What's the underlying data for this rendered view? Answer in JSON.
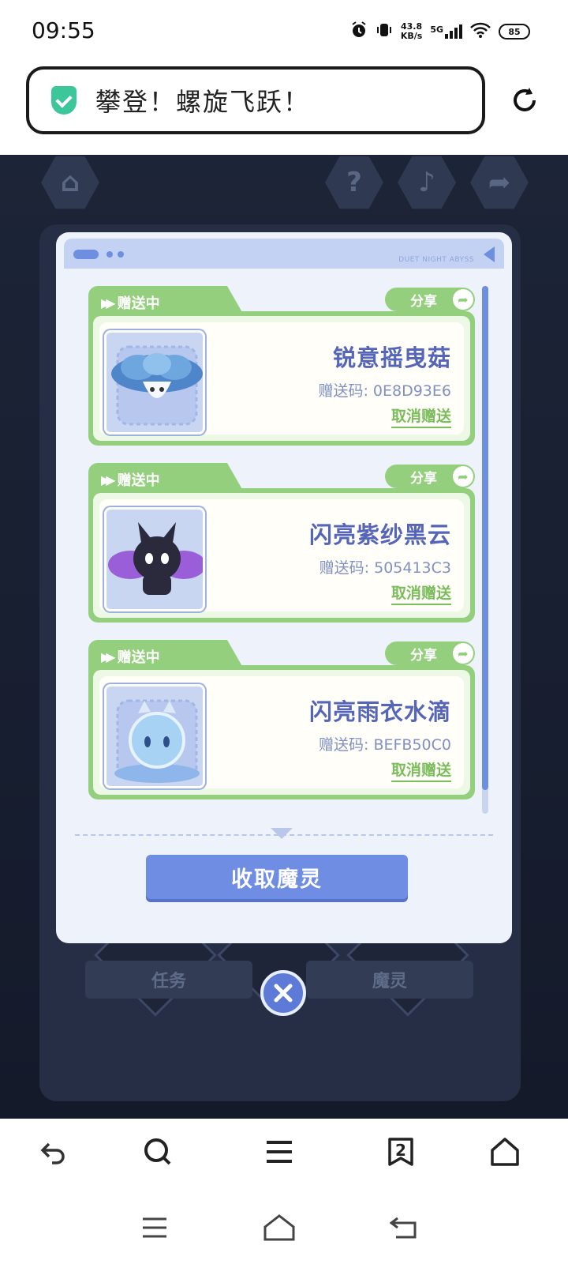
{
  "status_bar": {
    "time": "09:55",
    "net_speed_value": "43.8",
    "net_speed_unit": "KB/s",
    "network": "5G",
    "battery": "85",
    "icons": [
      "alarm-icon",
      "vibrate-icon",
      "signal-icon",
      "wifi-icon",
      "battery-icon"
    ]
  },
  "browser": {
    "page_title": "攀登！螺旋飞跃！",
    "tab_count": "2",
    "icons": [
      "shield-icon",
      "reload-icon",
      "back-icon",
      "search-icon",
      "menu-icon",
      "tabs-icon",
      "home-icon"
    ]
  },
  "modal": {
    "header_brand": "DUET NIGHT ABYSS",
    "status_label": "赠送中",
    "share_label": "分享",
    "cancel_label": "取消赠送",
    "code_prefix": "赠送码: ",
    "items": [
      {
        "name": "锐意摇曳菇",
        "code": "赠送码: 0E8D93E6"
      },
      {
        "name": "闪亮紫纱黑云",
        "code": "赠送码: 505413C3"
      },
      {
        "name": "闪亮雨衣水滴",
        "code": "赠送码: BEFB50C0"
      }
    ],
    "collect_button": "收取魔灵"
  },
  "game_background": {
    "tab_task": "任务",
    "tab_spirit": "魔灵"
  },
  "colors": {
    "accent_green": "#94cf7d",
    "accent_blue": "#6f8de3",
    "name_text": "#5566b8",
    "game_bg": "#1c2437"
  }
}
